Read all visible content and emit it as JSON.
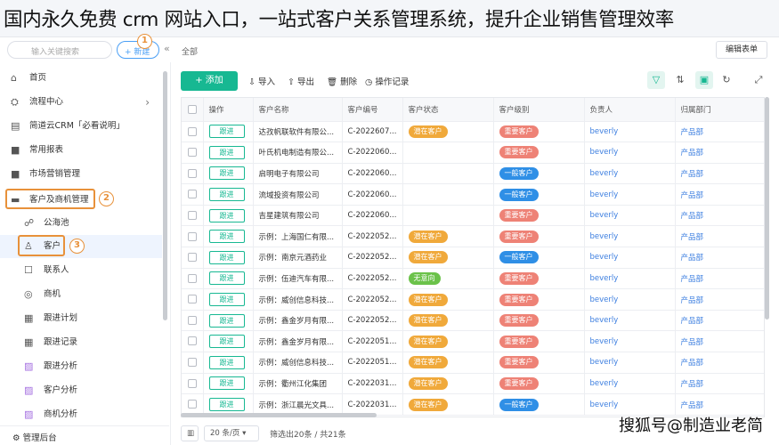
{
  "overlay": {
    "title": "国内永久免费 crm 网站入口，一站式客户关系管理系统，提升企业销售管理效率",
    "watermark": "搜狐号@制造业老简"
  },
  "topnav": {
    "search_placeholder": "输入关键搜索",
    "new_label": "+ 新建",
    "breadcrumb": "全部",
    "edit_form_label": "编辑表单",
    "step1": "1"
  },
  "sidebar": {
    "items": [
      {
        "label": "首页",
        "icon": "home-icon"
      },
      {
        "label": "流程中心",
        "icon": "flow-icon"
      },
      {
        "label": "简道云CRM「必看说明」",
        "icon": "doc-icon"
      },
      {
        "label": "常用报表",
        "icon": "folder-icon"
      },
      {
        "label": "市场营销管理",
        "icon": "folder-icon"
      },
      {
        "label": "客户及商机管理",
        "icon": "folder-open-icon"
      },
      {
        "label": "公海池",
        "icon": "users-icon"
      },
      {
        "label": "客户",
        "icon": "user-icon"
      },
      {
        "label": "联系人",
        "icon": "contact-icon"
      },
      {
        "label": "商机",
        "icon": "target-icon"
      },
      {
        "label": "跟进计划",
        "icon": "calendar-icon"
      },
      {
        "label": "跟进记录",
        "icon": "calendar-icon"
      },
      {
        "label": "跟进分析",
        "icon": "chart-icon"
      },
      {
        "label": "客户分析",
        "icon": "chart-icon"
      },
      {
        "label": "商机分析",
        "icon": "chart-icon"
      }
    ],
    "step2": "2",
    "step3": "3",
    "footer": "管理后台"
  },
  "toolbar": {
    "add": "+ 添加",
    "import": "导入",
    "export": "导出",
    "delete": "删除",
    "log": "操作记录"
  },
  "table": {
    "headers": [
      "操作",
      "客户名称",
      "客户编号",
      "客户状态",
      "客户级别",
      "负责人",
      "归属部门"
    ],
    "follow_label": "跟进",
    "rows": [
      {
        "name": "达孜帆联软件有限公...",
        "code": "C-2022607...",
        "status": "潜在客户",
        "level": "重要客户",
        "owner": "beverly",
        "dept": "产品部"
      },
      {
        "name": "叶氏机电制造有限公...",
        "code": "C-2022060...",
        "status": "",
        "level": "重要客户",
        "owner": "beverly",
        "dept": "产品部"
      },
      {
        "name": "启明电子有限公司",
        "code": "C-2022060...",
        "status": "",
        "level": "一般客户",
        "owner": "beverly",
        "dept": "产品部"
      },
      {
        "name": "流域投资有限公司",
        "code": "C-2022060...",
        "status": "",
        "level": "一般客户",
        "owner": "beverly",
        "dept": "产品部"
      },
      {
        "name": "吉星建筑有限公司",
        "code": "C-2022060...",
        "status": "",
        "level": "重要客户",
        "owner": "beverly",
        "dept": "产品部"
      },
      {
        "name": "示例：上海国仁有限...",
        "code": "C-2022052...",
        "status": "潜在客户",
        "level": "重要客户",
        "owner": "beverly",
        "dept": "产品部"
      },
      {
        "name": "示例：南京元酒药业",
        "code": "C-2022052...",
        "status": "潜在客户",
        "level": "一般客户",
        "owner": "beverly",
        "dept": "产品部"
      },
      {
        "name": "示例：伍迪汽车有限...",
        "code": "C-2022052...",
        "status": "无意向",
        "level": "重要客户",
        "owner": "beverly",
        "dept": "产品部"
      },
      {
        "name": "示例：威创信息科技...",
        "code": "C-2022052...",
        "status": "潜在客户",
        "level": "重要客户",
        "owner": "beverly",
        "dept": "产品部"
      },
      {
        "name": "示例：鑫金岁月有限...",
        "code": "C-2022052...",
        "status": "潜在客户",
        "level": "重要客户",
        "owner": "beverly",
        "dept": "产品部"
      },
      {
        "name": "示例：鑫金岁月有限...",
        "code": "C-2022051...",
        "status": "潜在客户",
        "level": "重要客户",
        "owner": "beverly",
        "dept": "产品部"
      },
      {
        "name": "示例：威创信息科技...",
        "code": "C-2022051...",
        "status": "潜在客户",
        "level": "重要客户",
        "owner": "beverly",
        "dept": "产品部"
      },
      {
        "name": "示例：衢州江化集团",
        "code": "C-2022031...",
        "status": "潜在客户",
        "level": "重要客户",
        "owner": "beverly",
        "dept": "产品部"
      },
      {
        "name": "示例：浙江晨光文具...",
        "code": "C-2022031...",
        "status": "潜在客户",
        "level": "一般客户",
        "owner": "beverly",
        "dept": "产品部"
      }
    ]
  },
  "pager": {
    "page_size": "20 条/页",
    "summary": "筛选出20条 / 共21条"
  },
  "colors": {
    "accent": "#17b892",
    "status_potential": "#f0a93b",
    "status_none": "#6bc24a",
    "level_important": "#ee8276",
    "level_normal": "#2f8fe6",
    "highlight": "#e8913a"
  }
}
